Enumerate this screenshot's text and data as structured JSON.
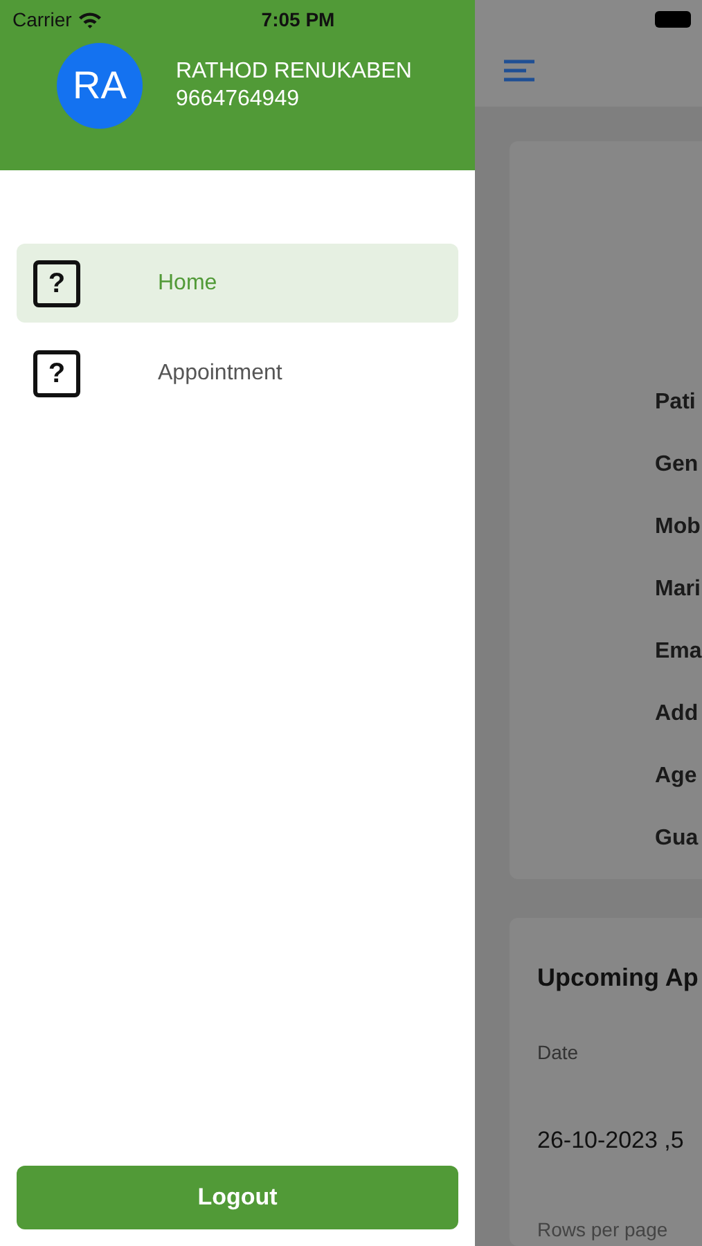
{
  "status_bar": {
    "carrier": "Carrier",
    "time": "7:05 PM"
  },
  "drawer": {
    "avatar": "RA",
    "name": "RATHOD RENUKABEN",
    "phone": "9664764949",
    "items": [
      {
        "icon": "?",
        "label": "Home",
        "selected": true
      },
      {
        "icon": "?",
        "label": "Appointment",
        "selected": false
      }
    ],
    "logout": "Logout"
  },
  "background": {
    "profile_labels": [
      "Pati",
      "Gen",
      "Mob",
      "Mari",
      "Ema",
      "Add",
      "Age",
      "Gua"
    ],
    "appointments": {
      "title": "Upcoming Ap",
      "column": "Date",
      "row": "26-10-2023 ,5",
      "footer": "Rows per page"
    }
  }
}
